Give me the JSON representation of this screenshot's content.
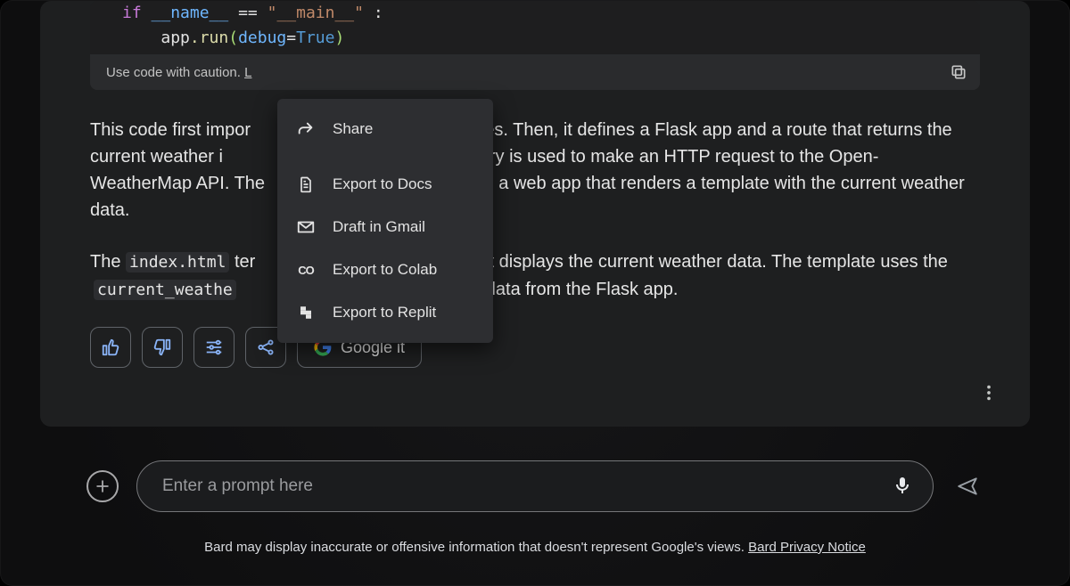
{
  "code": {
    "if_kw": "if",
    "name_var": "__name__",
    "eq": "==",
    "main_str": "\"__main__\"",
    "colon": ":",
    "indent_call": "app.run(debug=True)",
    "app": "app",
    "dot_run": ".run",
    "debug_kw": "debug",
    "eq2": "=",
    "true_kw": "True",
    "paren_open": "(",
    "paren_close": ")"
  },
  "caution": {
    "text": "Use code with caution.",
    "link_partial": "L"
  },
  "paragraph1": {
    "pre": "This code first impor",
    "gap1": "",
    "mid1": "aries. Then, it defines a Flask app and a route that returns the current weather i",
    "mid2": "ts library is used to make an HTTP request to the Open-WeatherMap API. The",
    "mid3": "te a web app that renders a template with the current weather data."
  },
  "paragraph2": {
    "pre": "The ",
    "code1": "index.html",
    "mid1": " ter",
    "gap1": "",
    "mid2": "hat displays the current weather data. The template uses the ",
    "code2": "current_weathe",
    "mid3": "",
    "mid4": "ther data from the Flask app."
  },
  "actions": {
    "google_it": "Google it"
  },
  "menu": {
    "share": "Share",
    "docs": "Export to Docs",
    "gmail": "Draft in Gmail",
    "colab": "Export to Colab",
    "replit": "Export to Replit",
    "colab_mark": "CO"
  },
  "prompt": {
    "placeholder": "Enter a prompt here"
  },
  "disclaimer": {
    "text": "Bard may display inaccurate or offensive information that doesn't represent Google's views. ",
    "link": "Bard Privacy Notice"
  }
}
